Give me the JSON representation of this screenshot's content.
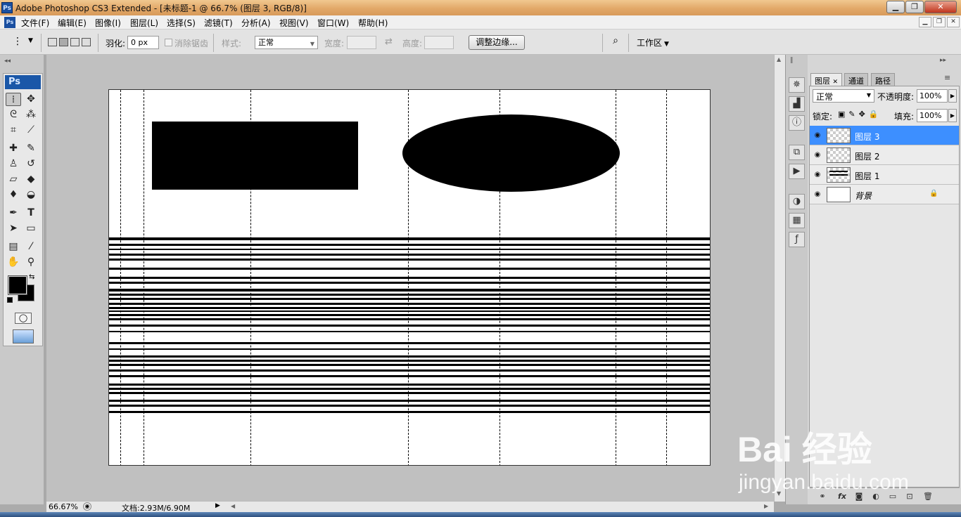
{
  "window": {
    "app_icon": "Ps",
    "title": "Adobe Photoshop CS3 Extended - [未标题-1 @ 66.7% (图层 3, RGB/8)]",
    "min_icon": "minimize-icon",
    "max_icon": "maximize-icon",
    "close_icon": "close-icon"
  },
  "menubar": {
    "items": [
      "文件(F)",
      "编辑(E)",
      "图像(I)",
      "图层(L)",
      "选择(S)",
      "滤镜(T)",
      "分析(A)",
      "视图(V)",
      "窗口(W)",
      "帮助(H)"
    ]
  },
  "options": {
    "feather_label": "羽化:",
    "feather_value": "0 px",
    "antialias_label": "消除锯齿",
    "style_label": "样式:",
    "style_value": "正常",
    "width_label": "宽度:",
    "height_label": "高度:",
    "refine_button": "调整边缘...",
    "workspace_label": "工作区"
  },
  "toolbox": {
    "logo": "Ps"
  },
  "layers_panel": {
    "tabs": [
      "图层",
      "通道",
      "路径"
    ],
    "blend_mode": "正常",
    "opacity_label": "不透明度:",
    "opacity_value": "100%",
    "lock_label": "锁定:",
    "fill_label": "填充:",
    "fill_value": "100%",
    "layers": [
      {
        "name": "图层 3",
        "selected": true
      },
      {
        "name": "图层 2",
        "selected": false
      },
      {
        "name": "图层 1",
        "selected": false
      },
      {
        "name": "背景",
        "selected": false,
        "locked": true
      }
    ]
  },
  "status": {
    "zoom": "66.67%",
    "doc_info": "文档:2.93M/6.90M"
  },
  "watermark": {
    "line1": "Bai 经验",
    "line2": "jingyan.baidu.com"
  },
  "colors": {
    "selected_layer": "#3d8fff",
    "foreground": "#000000",
    "background": "#000000"
  }
}
